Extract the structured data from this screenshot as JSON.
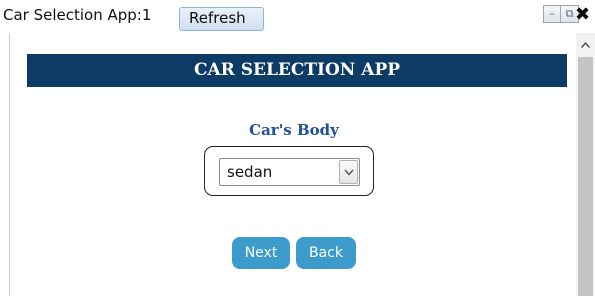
{
  "window": {
    "title": "Car Selection App:1",
    "refresh_label": "Refresh",
    "minimize_symbol": "–",
    "popout_symbol": "⧉",
    "close_symbol": "✖"
  },
  "header": {
    "title": "CAR SELECTION APP"
  },
  "form": {
    "label": "Car's Body",
    "select_value": "sedan"
  },
  "buttons": {
    "next_label": "Next",
    "back_label": "Back"
  },
  "colors": {
    "header_bg": "#0c3b66",
    "label_color": "#1f4e9c",
    "button_bg": "#3d9bcb"
  },
  "icons": {
    "scroll_up": "chevron-up-icon",
    "dropdown": "chevron-down-icon"
  }
}
